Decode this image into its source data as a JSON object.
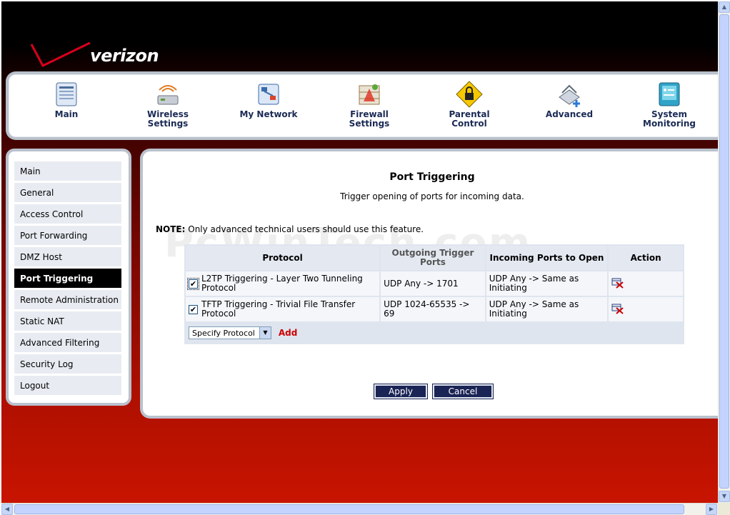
{
  "brand": {
    "name": "verizon"
  },
  "topnav": [
    {
      "label": "Main",
      "icon": "main-icon"
    },
    {
      "label": "Wireless Settings",
      "icon": "wireless-settings-icon"
    },
    {
      "label": "My Network",
      "icon": "my-network-icon"
    },
    {
      "label": "Firewall Settings",
      "icon": "firewall-settings-icon"
    },
    {
      "label": "Parental Control",
      "icon": "parental-control-icon"
    },
    {
      "label": "Advanced",
      "icon": "advanced-icon"
    },
    {
      "label": "System Monitoring",
      "icon": "system-monitoring-icon"
    }
  ],
  "sidebar": {
    "items": [
      {
        "label": "Main"
      },
      {
        "label": "General"
      },
      {
        "label": "Access Control"
      },
      {
        "label": "Port Forwarding"
      },
      {
        "label": "DMZ Host"
      },
      {
        "label": "Port Triggering"
      },
      {
        "label": "Remote Administration"
      },
      {
        "label": "Static NAT"
      },
      {
        "label": "Advanced Filtering"
      },
      {
        "label": "Security Log"
      },
      {
        "label": "Logout"
      }
    ],
    "active_index": 5
  },
  "content": {
    "title": "Port Triggering",
    "subtitle": "Trigger opening of ports for incoming data.",
    "note_label": "NOTE:",
    "note_text": " Only advanced technical users should use this feature.",
    "watermark": "PcWinTech.com"
  },
  "table": {
    "headers": {
      "protocol": "Protocol",
      "outgoing": "Outgoing Trigger Ports",
      "incoming": "Incoming Ports to Open",
      "action": "Action"
    },
    "rows": [
      {
        "checked": true,
        "protocol": "L2TP Triggering - Layer Two Tunneling Protocol",
        "outgoing": "UDP Any -> 1701",
        "incoming": "UDP Any -> Same as Initiating"
      },
      {
        "checked": true,
        "protocol": "TFTP Triggering - Trivial File Transfer Protocol",
        "outgoing": "UDP 1024-65535 -> 69",
        "incoming": "UDP Any -> Same as Initiating"
      }
    ],
    "add_select": "Specify Protocol",
    "add_label": "Add"
  },
  "buttons": {
    "apply": "Apply",
    "cancel": "Cancel"
  },
  "colors": {
    "accent": "#1a2455",
    "danger": "#cc0000",
    "nav_text": "#1a2a55"
  }
}
